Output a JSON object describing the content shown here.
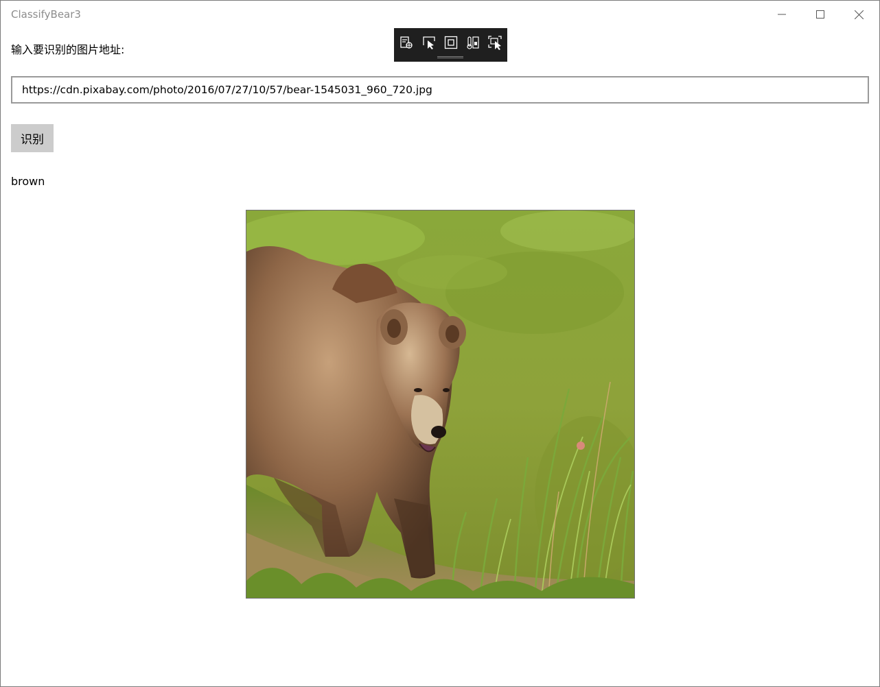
{
  "window": {
    "title": "ClassifyBear3"
  },
  "titlebar_buttons": [
    "minimize-icon",
    "maximize-icon",
    "close-icon"
  ],
  "debug_toolbar": {
    "tools": [
      "live-visual-tree-icon",
      "select-element-icon",
      "display-layout-adorners-icon",
      "track-focus-icon",
      "preview-selection-icon"
    ]
  },
  "form": {
    "prompt_label": "输入要识别的图片地址:",
    "url_value": "https://cdn.pixabay.com/photo/2016/07/27/10/57/bear-1545031_960_720.jpg",
    "classify_button": "识别"
  },
  "result": {
    "label": "brown"
  },
  "image": {
    "subject": "brown bear walking by a green pond with tall grass"
  }
}
